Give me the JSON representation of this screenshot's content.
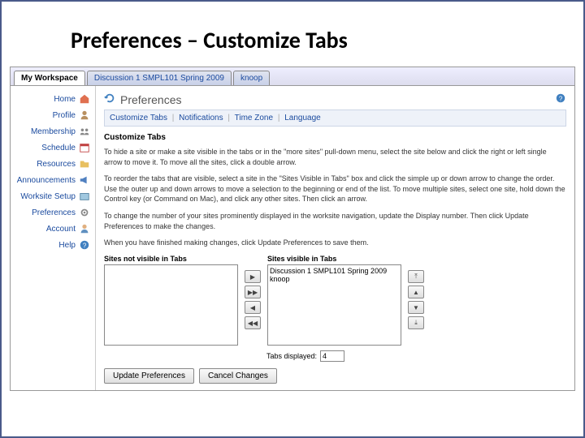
{
  "title": "Preferences – Customize Tabs",
  "tabs": {
    "t0": "My Workspace",
    "t1": "Discussion 1 SMPL101 Spring 2009",
    "t2": "knoop"
  },
  "sidebar": {
    "home": "Home",
    "profile": "Profile",
    "membership": "Membership",
    "schedule": "Schedule",
    "resources": "Resources",
    "announcements": "Announcements",
    "worksite": "Worksite Setup",
    "preferences": "Preferences",
    "account": "Account",
    "help": "Help"
  },
  "pref": {
    "heading": "Preferences",
    "sub_customize": "Customize Tabs",
    "sub_notifications": "Notifications",
    "sub_timezone": "Time Zone",
    "sub_language": "Language",
    "section_title": "Customize Tabs",
    "p1": "To hide a site or make a site visible in the tabs or in the \"more sites\" pull-down menu, select the site below and click the right or left single arrow to move it. To move all the sites, click a double arrow.",
    "p2": "To reorder the tabs that are visible, select a site in the \"Sites Visible in Tabs\" box and click the simple up or down arrow to change the order. Use the outer up and down arrows to move a selection to the beginning or end of the list. To move multiple sites, select one site, hold down the Control key (or Command on Mac), and click any other sites. Then click an arrow.",
    "p3": "To change the number of your sites prominently displayed in the worksite navigation, update the Display number. Then click Update Preferences to make the changes.",
    "p4": "When you have finished making changes, click Update Preferences to save them.",
    "left_label": "Sites not visible in Tabs",
    "right_label": "Sites visible in Tabs",
    "right_item1": "Discussion 1 SMPL101 Spring 2009",
    "right_item2": "knoop",
    "tabs_displayed_label": "Tabs displayed:",
    "tabs_displayed_value": "4",
    "btn_update": "Update Preferences",
    "btn_cancel": "Cancel Changes"
  }
}
